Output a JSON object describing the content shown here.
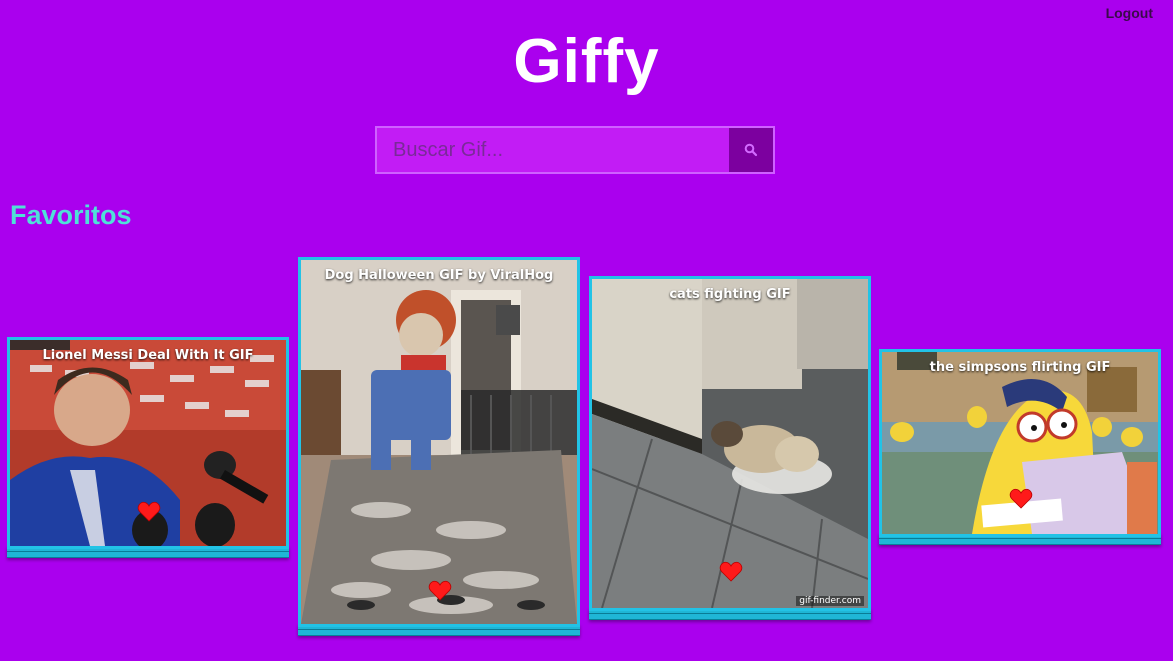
{
  "header": {
    "logout_label": "Logout",
    "brand": "Giffy"
  },
  "search": {
    "placeholder": "Buscar Gif...",
    "value": "",
    "button_icon": "search-icon"
  },
  "favorites": {
    "title": "Favoritos",
    "items": [
      {
        "title": "Lionel Messi Deal With It GIF",
        "favorited": true,
        "icon": "heart-icon"
      },
      {
        "title": "Dog Halloween GIF by ViralHog",
        "favorited": true,
        "icon": "heart-icon"
      },
      {
        "title": "cats fighting GIF",
        "favorited": true,
        "icon": "heart-icon",
        "watermark": "gif-finder.com"
      },
      {
        "title": "the simpsons flirting GIF",
        "favorited": true,
        "icon": "heart-icon"
      }
    ]
  },
  "colors": {
    "background": "#aa00ee",
    "accent": "#22c3e6",
    "section_title": "#4fe0d8",
    "heart": "#ff1a1a"
  }
}
